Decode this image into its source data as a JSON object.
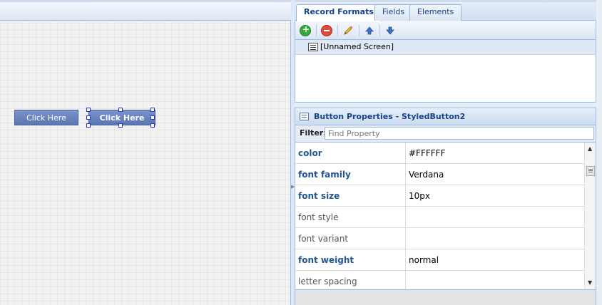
{
  "canvas": {
    "buttons": [
      {
        "label": "Click Here"
      },
      {
        "label": "Click Here",
        "selected": true
      }
    ]
  },
  "tabs": [
    {
      "label": "Record Formats",
      "active": true
    },
    {
      "label": "Fields",
      "active": false
    },
    {
      "label": "Elements",
      "active": false
    }
  ],
  "toolbar": {
    "icons": [
      "add-icon",
      "remove-icon",
      "edit-icon",
      "move-up-icon",
      "move-down-icon"
    ]
  },
  "records": [
    {
      "label": "[Unnamed Screen]"
    }
  ],
  "properties": {
    "title": "Button Properties - StyledButton2",
    "filter_label": "Filter:",
    "filter_placeholder": "Find Property",
    "rows": [
      {
        "name": "color",
        "value": "#FFFFFF",
        "bold": true
      },
      {
        "name": "font family",
        "value": "Verdana",
        "bold": true
      },
      {
        "name": "font size",
        "value": "10px",
        "bold": true
      },
      {
        "name": "font style",
        "value": "",
        "bold": false
      },
      {
        "name": "font variant",
        "value": "",
        "bold": false
      },
      {
        "name": "font weight",
        "value": "normal",
        "bold": true
      },
      {
        "name": "letter spacing",
        "value": "",
        "bold": false
      }
    ]
  },
  "colors": {
    "header_text": "#15428B",
    "border": "#99BBE8",
    "button_bg": "#5A76B1",
    "selection_handle": "#2333CC",
    "property_name_bold": "#23558F"
  }
}
